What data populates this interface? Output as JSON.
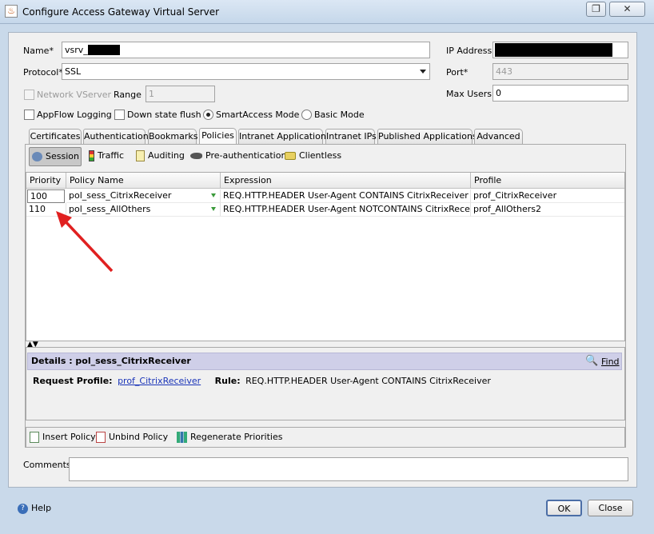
{
  "window": {
    "title": "Configure Access Gateway Virtual Server",
    "restore_glyph": "❐",
    "close_glyph": "✕"
  },
  "form": {
    "name_label": "Name*",
    "name_value": "vsrv_",
    "protocol_label": "Protocol*",
    "protocol_value": "SSL",
    "ip_label": "IP Address",
    "ip_value": "",
    "port_label": "Port*",
    "port_value": "443",
    "network_vserver_label": "Network VServer",
    "range_label": "Range",
    "range_value": "1",
    "max_users_label": "Max Users",
    "max_users_value": "0",
    "appflow_label": "AppFlow Logging",
    "down_state_label": "Down state flush",
    "smartaccess_label": "SmartAccess Mode",
    "basic_mode_label": "Basic Mode"
  },
  "tabs": [
    "Certificates",
    "Authentication",
    "Bookmarks",
    "Policies",
    "Intranet Applications",
    "Intranet IPs",
    "Published Applications",
    "Advanced"
  ],
  "active_tab": "Policies",
  "subtabs": [
    "Session",
    "Traffic",
    "Auditing",
    "Pre-authentication",
    "Clientless"
  ],
  "active_subtab": "Session",
  "grid": {
    "columns": [
      "Priority",
      "Policy Name",
      "Expression",
      "Profile"
    ],
    "rows": [
      {
        "priority": "100",
        "policy": "pol_sess_CitrixReceiver",
        "expression": "REQ.HTTP.HEADER User-Agent CONTAINS CitrixReceiver",
        "profile": "prof_CitrixReceiver"
      },
      {
        "priority": "110",
        "policy": "pol_sess_AllOthers",
        "expression": "REQ.HTTP.HEADER User-Agent NOTCONTAINS CitrixReceiver",
        "profile": "prof_AllOthers2"
      }
    ]
  },
  "details": {
    "title": "Details : pol_sess_CitrixReceiver",
    "find_label": "Find",
    "request_profile_label": "Request Profile:",
    "request_profile_value": "prof_CitrixReceiver",
    "rule_label": "Rule:",
    "rule_value": "REQ.HTTP.HEADER User-Agent CONTAINS CitrixReceiver"
  },
  "actions": {
    "insert_policy": "Insert Policy",
    "unbind_policy": "Unbind Policy",
    "regenerate_priorities": "Regenerate Priorities"
  },
  "comments_label": "Comments",
  "comments_value": "",
  "footer": {
    "help": "Help",
    "ok": "OK",
    "close": "Close"
  },
  "colors": {
    "annotation_arrow": "#e02020",
    "redaction": "#000000",
    "details_header": "#cfcfe8"
  }
}
